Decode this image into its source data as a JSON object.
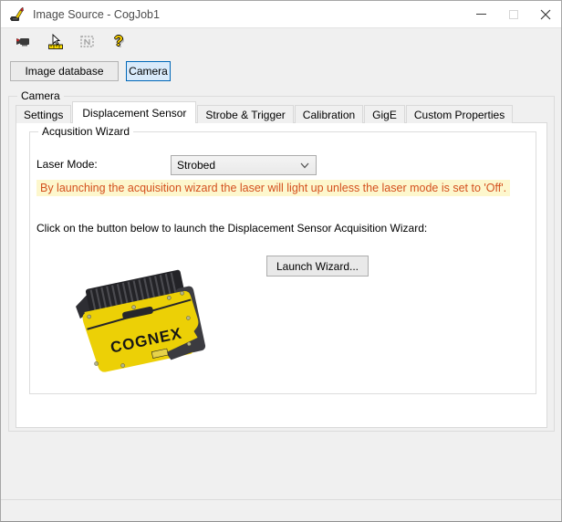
{
  "window": {
    "title": "Image Source - CogJob1"
  },
  "toolbar": {
    "icons": [
      {
        "name": "camera-tool-icon"
      },
      {
        "name": "ruler-pointer-tool-icon"
      },
      {
        "name": "region-tool-disabled-icon"
      },
      {
        "name": "help-icon",
        "glyph": "?"
      }
    ]
  },
  "source_buttons": {
    "image_database": "Image database",
    "camera": "Camera"
  },
  "camera_group": {
    "label": "Camera"
  },
  "tabs": [
    {
      "label": "Settings",
      "active": false
    },
    {
      "label": "Displacement Sensor",
      "active": true
    },
    {
      "label": "Strobe & Trigger",
      "active": false
    },
    {
      "label": "Calibration",
      "active": false
    },
    {
      "label": "GigE",
      "active": false
    },
    {
      "label": "Custom Properties",
      "active": false
    }
  ],
  "acq": {
    "group_label": "Acqusition Wizard",
    "laser_mode_label": "Laser Mode:",
    "laser_mode_value": "Strobed",
    "warning": "By launching the acquisition wizard the laser will light up unless the laser mode is set to 'Off'.",
    "instruction": "Click on the button below to launch the Displacement Sensor Acquisition Wizard:",
    "launch_button": "Launch Wizard...",
    "camera_label": "COGNEX"
  },
  "colors": {
    "selected_button_border": "#0067b8",
    "selected_button_bg": "#d9eafa",
    "warning_text": "#d4501e",
    "warning_bg": "#fdf7cd",
    "brand_yellow": "#ecd006",
    "window_bg": "#f0f0f0"
  }
}
